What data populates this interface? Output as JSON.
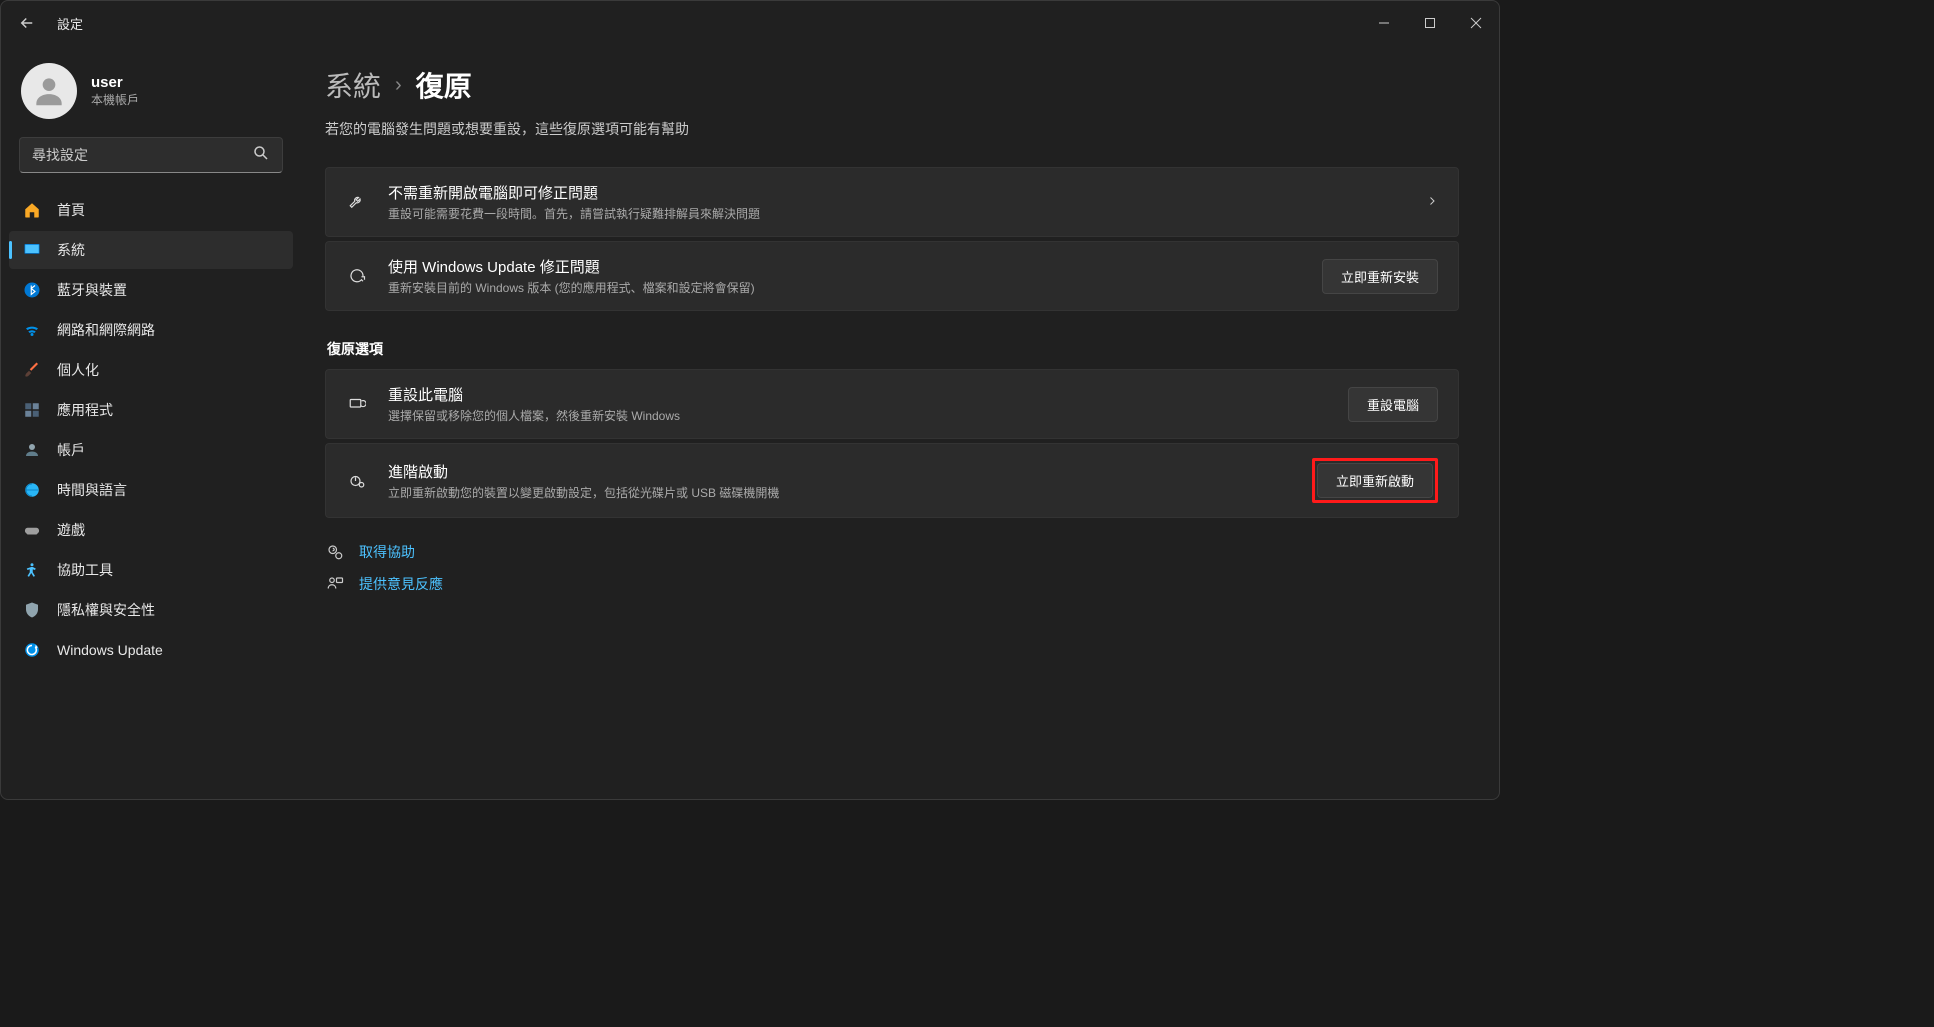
{
  "titlebar": {
    "app_title": "設定"
  },
  "user": {
    "name": "user",
    "sub": "本機帳戶"
  },
  "search": {
    "placeholder": "尋找設定"
  },
  "nav": [
    {
      "label": "首頁"
    },
    {
      "label": "系統"
    },
    {
      "label": "藍牙與裝置"
    },
    {
      "label": "網路和網際網路"
    },
    {
      "label": "個人化"
    },
    {
      "label": "應用程式"
    },
    {
      "label": "帳戶"
    },
    {
      "label": "時間與語言"
    },
    {
      "label": "遊戲"
    },
    {
      "label": "協助工具"
    },
    {
      "label": "隱私權與安全性"
    },
    {
      "label": "Windows Update"
    }
  ],
  "breadcrumb": {
    "parent": "系統",
    "sep": "›",
    "current": "復原"
  },
  "subtitle": "若您的電腦發生問題或想要重設，這些復原選項可能有幫助",
  "cards": {
    "fix_without_restart": {
      "title": "不需重新開啟電腦即可修正問題",
      "desc": "重設可能需要花費一段時間。首先，請嘗試執行疑難排解員來解決問題"
    },
    "windows_update_fix": {
      "title": "使用 Windows Update 修正問題",
      "desc": "重新安裝目前的 Windows 版本 (您的應用程式、檔案和設定將會保留)",
      "button": "立即重新安裝"
    }
  },
  "section_recovery": "復原選項",
  "recovery": {
    "reset_pc": {
      "title": "重設此電腦",
      "desc": "選擇保留或移除您的個人檔案，然後重新安裝 Windows",
      "button": "重設電腦"
    },
    "advanced_startup": {
      "title": "進階啟動",
      "desc": "立即重新啟動您的裝置以變更啟動設定，包括從光碟片或 USB 磁碟機開機",
      "button": "立即重新啟動"
    }
  },
  "footer": {
    "help": "取得協助",
    "feedback": "提供意見反應"
  }
}
